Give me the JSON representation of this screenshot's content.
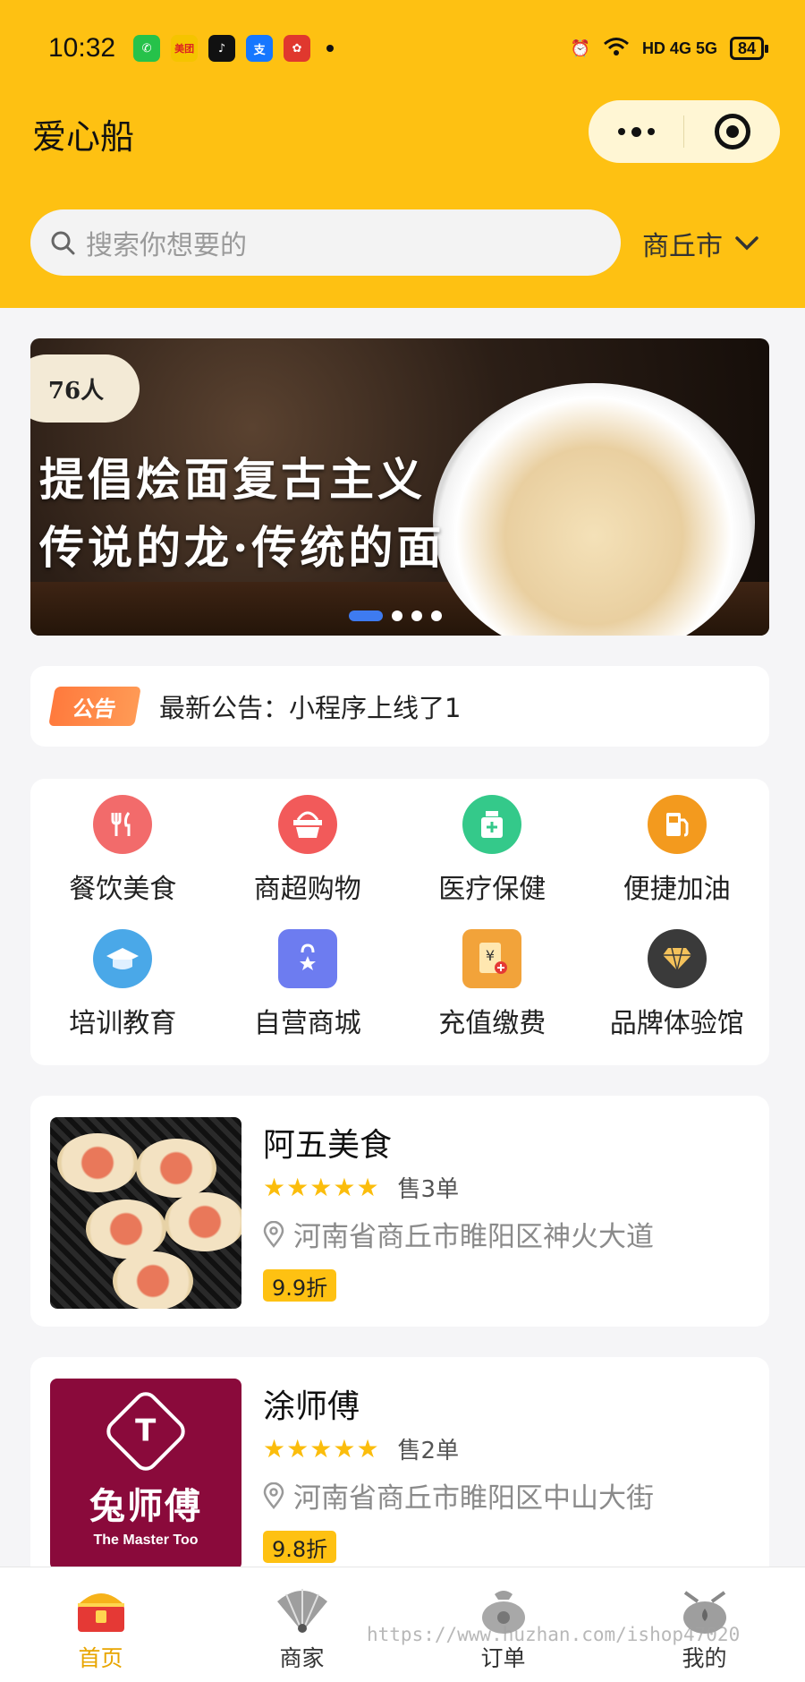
{
  "status_bar": {
    "time": "10:32",
    "apps": [
      {
        "icon": "phone-app-icon",
        "color": "#26c24a",
        "glyph": "✆"
      },
      {
        "icon": "meituan-app-icon",
        "color": "#f5c400",
        "glyph": "美团"
      },
      {
        "icon": "tiktok-app-icon",
        "color": "#111111",
        "glyph": "♪"
      },
      {
        "icon": "alipay-app-icon",
        "color": "#1677ff",
        "glyph": "支"
      },
      {
        "icon": "flower-app-icon",
        "color": "#e0382e",
        "glyph": "✿"
      }
    ],
    "network": "HD 4G 5G",
    "battery": "84"
  },
  "header": {
    "title": "爱心船"
  },
  "search": {
    "placeholder": "搜索你想要的",
    "city": "商丘市"
  },
  "banner": {
    "logo_text": "76人",
    "line1": "提倡烩面复古主义",
    "line2": "传说的龙·传统的面",
    "slide_count": 4,
    "active_slide": 1
  },
  "notice": {
    "tag": "公告",
    "text": "最新公告：小程序上线了1"
  },
  "categories": [
    {
      "label": "餐饮美食",
      "icon": "fork-knife-icon",
      "color": "#f26b6b",
      "glyph": "🍴"
    },
    {
      "label": "商超购物",
      "icon": "basket-icon",
      "color": "#f25a5a",
      "glyph": "🧺"
    },
    {
      "label": "医疗保健",
      "icon": "medicine-bottle-icon",
      "color": "#34c98a",
      "glyph": "+"
    },
    {
      "label": "便捷加油",
      "icon": "fuel-pump-icon",
      "color": "#f39a1e",
      "glyph": "⛽"
    },
    {
      "label": "培训教育",
      "icon": "graduation-cap-icon",
      "color": "#4aa8e8",
      "glyph": "🎓"
    },
    {
      "label": "自营商城",
      "icon": "shopping-bag-icon",
      "color": "#6d7cf0",
      "glyph": "★"
    },
    {
      "label": "充值缴费",
      "icon": "recharge-icon",
      "color": "#f2a33a",
      "glyph": "¥"
    },
    {
      "label": "品牌体验馆",
      "icon": "diamond-icon",
      "color": "#3a3a3a",
      "glyph": "◆"
    }
  ],
  "stores": [
    {
      "name": "阿五美食",
      "rating": 5,
      "sold": "售3单",
      "address": "河南省商丘市睢阳区神火大道",
      "discount": "9.9折"
    },
    {
      "name": "涂师傅",
      "rating": 5,
      "sold": "售2单",
      "address": "河南省商丘市睢阳区中山大街",
      "discount": "9.8折",
      "logo_cn": "兔师傅",
      "logo_en": "The Master Too",
      "logo_mark": "T"
    }
  ],
  "tabs": [
    {
      "label": "首页",
      "icon": "home-chest-icon",
      "active": true
    },
    {
      "label": "商家",
      "icon": "fan-merchant-icon",
      "active": false
    },
    {
      "label": "订单",
      "icon": "money-bag-icon",
      "active": false
    },
    {
      "label": "我的",
      "icon": "pot-user-icon",
      "active": false
    }
  ],
  "watermark": "https://www.huzhan.com/ishop47020",
  "colors": {
    "accent": "#fec112",
    "notice_tag": "#ff7a3d",
    "star": "#fbbd0c",
    "dot_active": "#3e7bf0"
  }
}
